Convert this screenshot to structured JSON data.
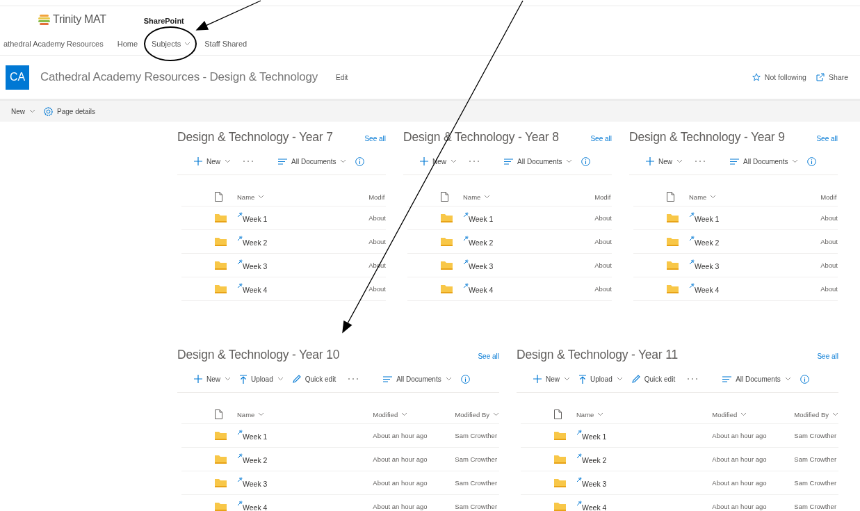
{
  "app": {
    "logo_text": "Trinity MAT",
    "product": "SharePoint"
  },
  "nav": [
    {
      "label": "athedral Academy Resources",
      "has_menu": false
    },
    {
      "label": "Home",
      "has_menu": false
    },
    {
      "label": "Subjects",
      "has_menu": true
    },
    {
      "label": "Staff Shared",
      "has_menu": false
    }
  ],
  "site": {
    "initials": "CA",
    "title": "Cathedral Academy Resources - Design & Technology",
    "edit": "Edit",
    "actions": [
      {
        "kind": "follow",
        "label": "Not following"
      },
      {
        "kind": "share",
        "label": "Share"
      }
    ]
  },
  "command_bar": [
    {
      "kind": "new",
      "label": "New"
    },
    {
      "kind": "details",
      "label": "Page details"
    }
  ],
  "library_rows": [
    {
      "libraries": [
        {
          "title": "Design & Technology - Year 7",
          "see_all": "See all",
          "toolbar": [
            {
              "kind": "new",
              "label": "New"
            },
            {
              "kind": "more"
            },
            {
              "kind": "view",
              "label": "All Documents"
            },
            {
              "kind": "info"
            }
          ],
          "columns": [
            {
              "label": "Name",
              "has_menu": true
            },
            {
              "label": "Modif",
              "has_menu": false
            }
          ],
          "rows": [
            {
              "cells": [
                "Week 1",
                "About"
              ]
            },
            {
              "cells": [
                "Week 2",
                "About"
              ]
            },
            {
              "cells": [
                "Week 3",
                "About"
              ]
            },
            {
              "cells": [
                "Week 4",
                "About"
              ]
            }
          ]
        },
        {
          "title": "Design & Technology - Year 8",
          "see_all": "See all",
          "toolbar": [
            {
              "kind": "new",
              "label": "New"
            },
            {
              "kind": "more"
            },
            {
              "kind": "view",
              "label": "All Documents"
            },
            {
              "kind": "info"
            }
          ],
          "columns": [
            {
              "label": "Name",
              "has_menu": true
            },
            {
              "label": "Modif",
              "has_menu": false
            }
          ],
          "rows": [
            {
              "cells": [
                "Week 1",
                "About"
              ]
            },
            {
              "cells": [
                "Week 2",
                "About"
              ]
            },
            {
              "cells": [
                "Week 3",
                "About"
              ]
            },
            {
              "cells": [
                "Week 4",
                "About"
              ]
            }
          ]
        },
        {
          "title": "Design & Technology - Year 9",
          "see_all": "See all",
          "toolbar": [
            {
              "kind": "new",
              "label": "New"
            },
            {
              "kind": "more"
            },
            {
              "kind": "view",
              "label": "All Documents"
            },
            {
              "kind": "info"
            }
          ],
          "columns": [
            {
              "label": "Name",
              "has_menu": true
            },
            {
              "label": "Modif",
              "has_menu": false
            }
          ],
          "rows": [
            {
              "cells": [
                "Week 1",
                "About"
              ]
            },
            {
              "cells": [
                "Week 2",
                "About"
              ]
            },
            {
              "cells": [
                "Week 3",
                "About"
              ]
            },
            {
              "cells": [
                "Week 4",
                "About"
              ]
            }
          ]
        }
      ]
    },
    {
      "libraries": [
        {
          "title": "Design & Technology - Year 10",
          "see_all": "See all",
          "toolbar": [
            {
              "kind": "new",
              "label": "New"
            },
            {
              "kind": "upload",
              "label": "Upload"
            },
            {
              "kind": "quick_edit",
              "label": "Quick edit"
            },
            {
              "kind": "more"
            },
            {
              "kind": "view",
              "label": "All Documents"
            },
            {
              "kind": "info"
            }
          ],
          "columns": [
            {
              "label": "Name",
              "has_menu": true
            },
            {
              "label": "Modified",
              "has_menu": true
            },
            {
              "label": "Modified By",
              "has_menu": true
            }
          ],
          "rows": [
            {
              "cells": [
                "Week 1",
                "About an hour ago",
                "Sam Crowther"
              ]
            },
            {
              "cells": [
                "Week 2",
                "About an hour ago",
                "Sam Crowther"
              ]
            },
            {
              "cells": [
                "Week 3",
                "About an hour ago",
                "Sam Crowther"
              ]
            },
            {
              "cells": [
                "Week 4",
                "About an hour ago",
                "Sam Crowther"
              ]
            }
          ]
        },
        {
          "title": "Design & Technology - Year 11",
          "see_all": "See all",
          "toolbar": [
            {
              "kind": "new",
              "label": "New"
            },
            {
              "kind": "upload",
              "label": "Upload"
            },
            {
              "kind": "quick_edit",
              "label": "Quick edit"
            },
            {
              "kind": "more"
            },
            {
              "kind": "view",
              "label": "All Documents"
            },
            {
              "kind": "info"
            }
          ],
          "columns": [
            {
              "label": "Name",
              "has_menu": true
            },
            {
              "label": "Modified",
              "has_menu": true
            },
            {
              "label": "Modified By",
              "has_menu": true
            }
          ],
          "rows": [
            {
              "cells": [
                "Week 1",
                "About an hour ago",
                "Sam Crowther"
              ]
            },
            {
              "cells": [
                "Week 2",
                "About an hour ago",
                "Sam Crowther"
              ]
            },
            {
              "cells": [
                "Week 3",
                "About an hour ago",
                "Sam Crowther"
              ]
            },
            {
              "cells": [
                "Week 4",
                "About an hour ago",
                "Sam Crowther"
              ]
            }
          ]
        }
      ]
    }
  ],
  "annotations": [
    {
      "kind": "arrow"
    },
    {
      "kind": "circle"
    },
    {
      "kind": "arrow"
    }
  ]
}
